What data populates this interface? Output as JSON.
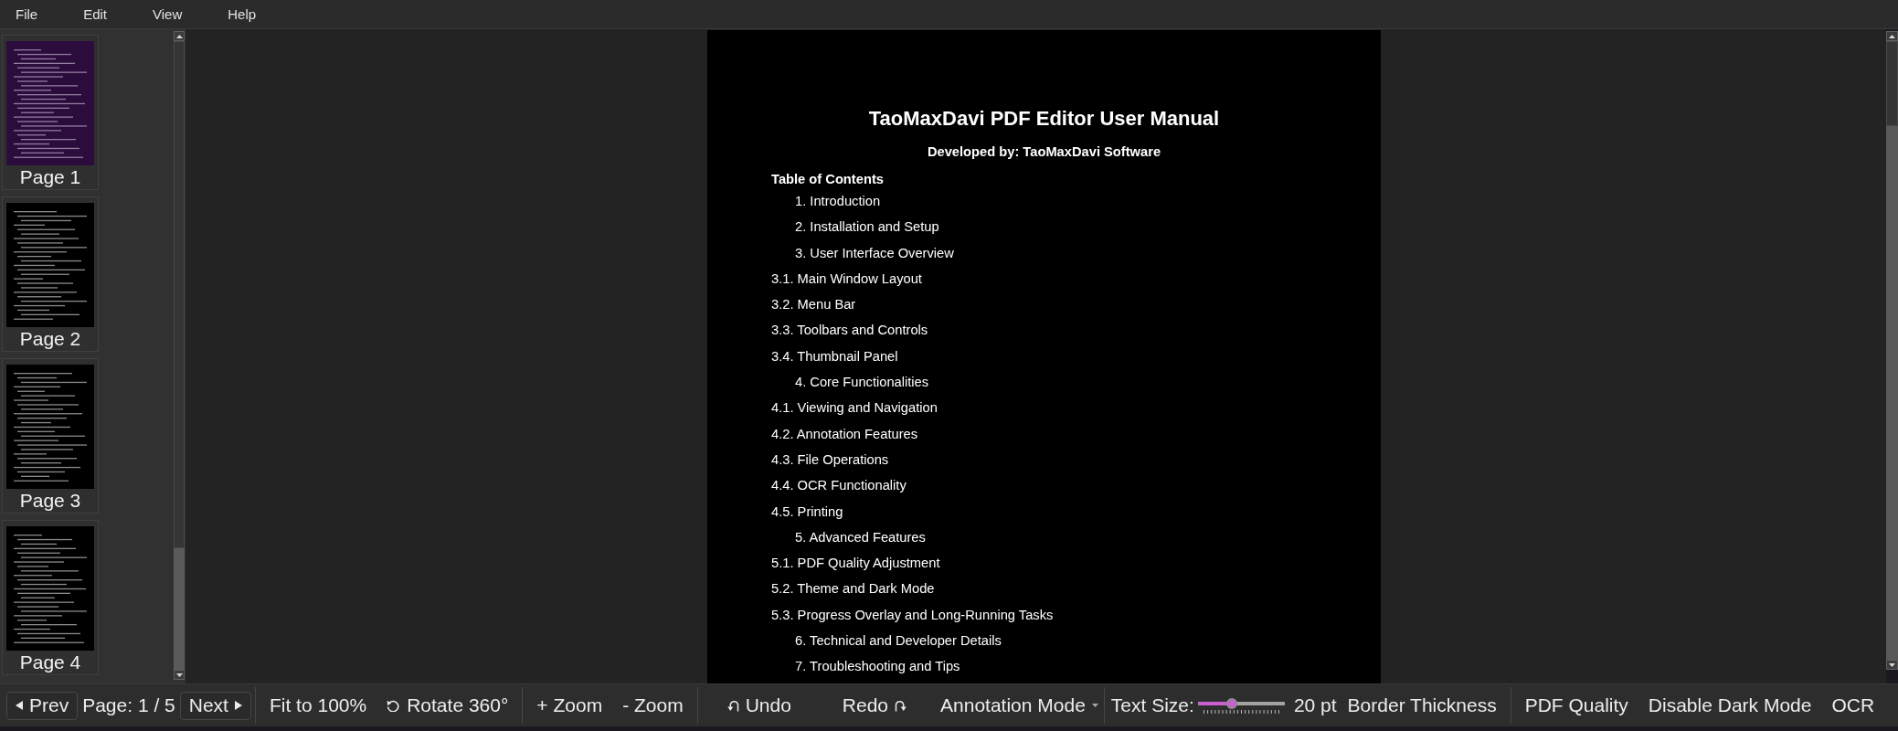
{
  "menu_bar": [
    {
      "label": "File"
    },
    {
      "label": "Edit"
    },
    {
      "label": "View"
    },
    {
      "label": "Help"
    }
  ],
  "thumbnails": [
    {
      "label": "Page 1",
      "selected": true
    },
    {
      "label": "Page 2",
      "selected": false
    },
    {
      "label": "Page 3",
      "selected": false
    },
    {
      "label": "Page 4",
      "selected": false
    }
  ],
  "document": {
    "title": "TaoMaxDavi PDF Editor User Manual",
    "subtitle": "Developed by: TaoMaxDavi Software",
    "toc_heading": "Table of Contents",
    "toc": [
      {
        "kind": "section",
        "text": "1. Introduction"
      },
      {
        "kind": "section",
        "text": "2. Installation and Setup"
      },
      {
        "kind": "section",
        "text": "3. User Interface Overview"
      },
      {
        "kind": "subsection",
        "text": "3.1. Main Window Layout"
      },
      {
        "kind": "subsection",
        "text": "3.2. Menu Bar"
      },
      {
        "kind": "subsection",
        "text": "3.3. Toolbars and Controls"
      },
      {
        "kind": "subsection",
        "text": "3.4. Thumbnail Panel"
      },
      {
        "kind": "section",
        "text": "4. Core Functionalities"
      },
      {
        "kind": "subsection",
        "text": "4.1. Viewing and Navigation"
      },
      {
        "kind": "subsection",
        "text": "4.2. Annotation Features"
      },
      {
        "kind": "subsection",
        "text": "4.3. File Operations"
      },
      {
        "kind": "subsection",
        "text": "4.4. OCR Functionality"
      },
      {
        "kind": "subsection",
        "text": "4.5. Printing"
      },
      {
        "kind": "section",
        "text": "5. Advanced Features"
      },
      {
        "kind": "subsection",
        "text": "5.1. PDF Quality Adjustment"
      },
      {
        "kind": "subsection",
        "text": "5.2. Theme and Dark Mode"
      },
      {
        "kind": "subsection",
        "text": "5.3. Progress Overlay and Long-Running Tasks"
      },
      {
        "kind": "section",
        "text": "6. Technical and Developer Details"
      },
      {
        "kind": "section",
        "text": "7. Troubleshooting and Tips"
      }
    ]
  },
  "toolbar": {
    "groups": [
      {
        "items": [
          {
            "kind": "prev",
            "label": "Prev"
          },
          {
            "kind": "label",
            "label": "Page: 1 / 5"
          },
          {
            "kind": "next",
            "label": "Next"
          }
        ]
      },
      {
        "items": [
          {
            "kind": "button",
            "label": "Fit to 100%"
          },
          {
            "kind": "rotate",
            "label": "Rotate 360°"
          }
        ]
      },
      {
        "items": [
          {
            "kind": "button",
            "label": "+ Zoom"
          },
          {
            "kind": "button",
            "label": "- Zoom"
          }
        ]
      },
      {
        "items": [
          {
            "kind": "undo",
            "label": "Undo"
          },
          {
            "kind": "redo",
            "label": "Redo"
          },
          {
            "kind": "dropdown",
            "label": "Annotation Mode"
          }
        ]
      },
      {
        "items": [
          {
            "kind": "label",
            "label": "Text Size:"
          },
          {
            "kind": "slider",
            "level": 0.38
          },
          {
            "kind": "reading",
            "label": "20 pt"
          },
          {
            "kind": "button",
            "label": "Border Thickness"
          }
        ]
      },
      {
        "items": [
          {
            "kind": "button",
            "label": "PDF Quality"
          },
          {
            "kind": "button",
            "label": "Disable Dark Mode"
          },
          {
            "kind": "button",
            "label": "OCR"
          }
        ]
      }
    ]
  }
}
